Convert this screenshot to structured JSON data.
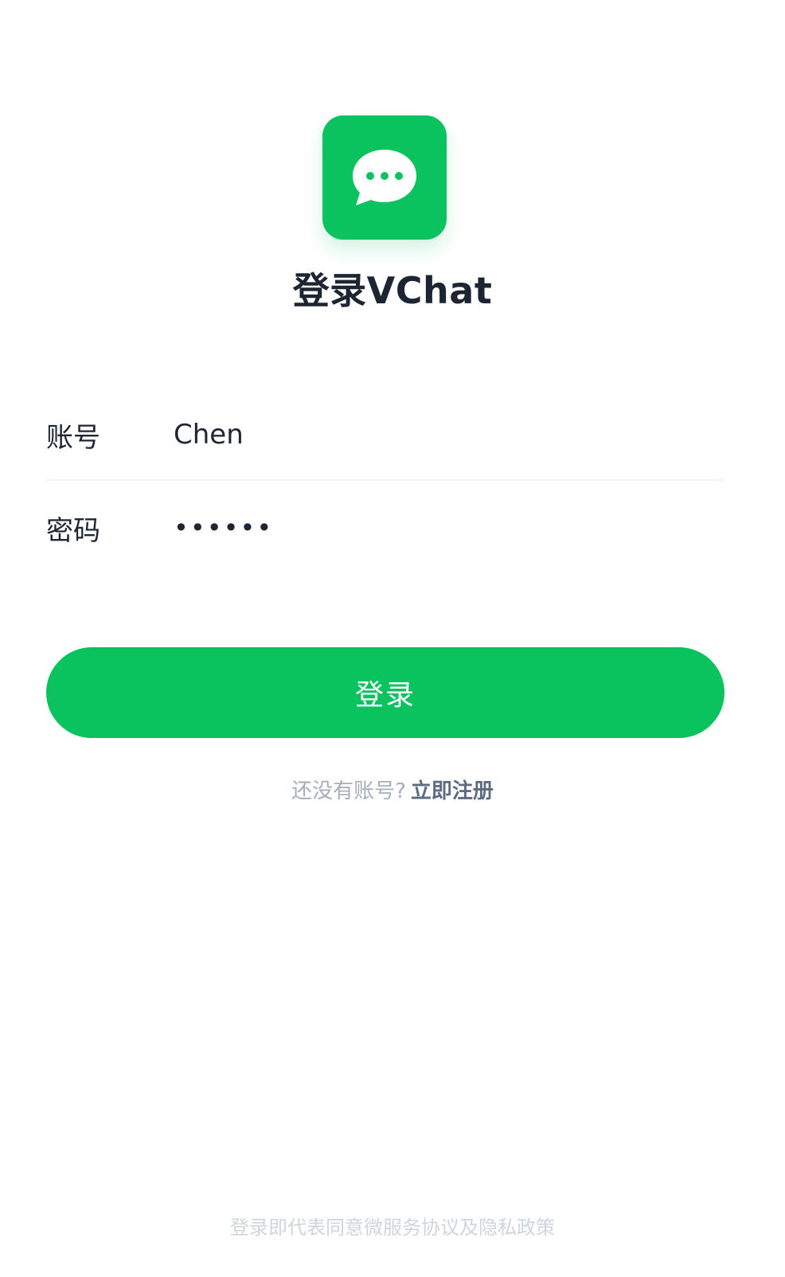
{
  "app": {
    "logo_icon": "chat-bubble-icon",
    "brand_color": "#0ac35f",
    "title": "登录VChat"
  },
  "form": {
    "account": {
      "label": "账号",
      "value": "Chen"
    },
    "password": {
      "label": "密码",
      "value": "••••••"
    }
  },
  "actions": {
    "login_label": "登录",
    "register_question": "还没有账号?",
    "register_link": "立即注册"
  },
  "footer": {
    "agreement": "登录即代表同意微服务协议及隐私政策"
  }
}
